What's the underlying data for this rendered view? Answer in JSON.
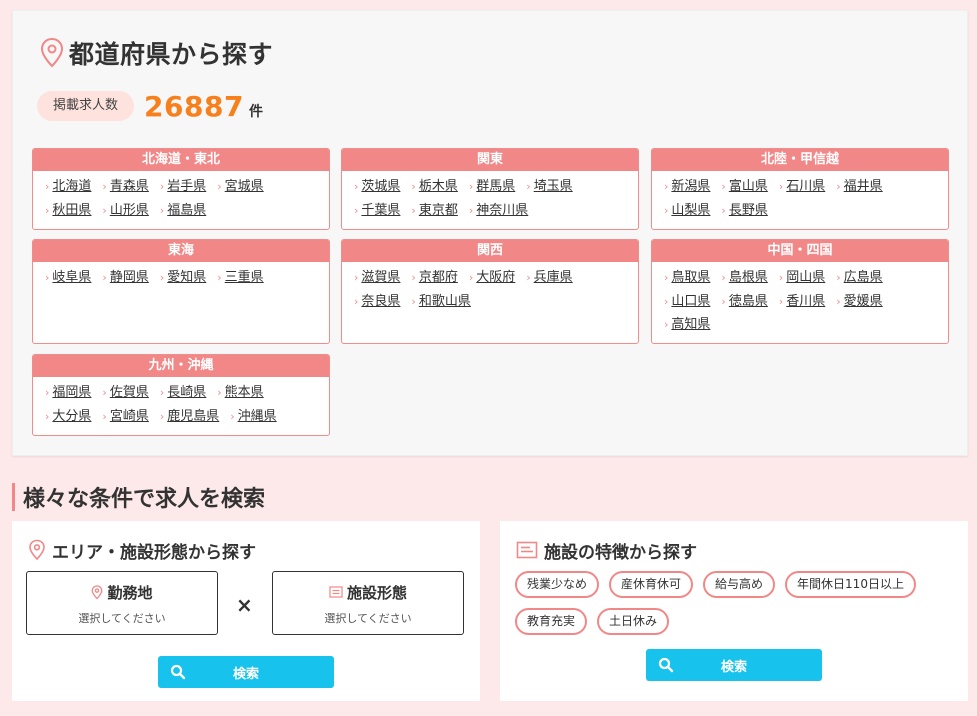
{
  "prefecture_section": {
    "title": "都道府県から探す",
    "count_label": "掲載求人数",
    "count_value": "26887",
    "count_unit": "件",
    "regions": [
      {
        "name": "北海道・東北",
        "prefectures": [
          "北海道",
          "青森県",
          "岩手県",
          "宮城県",
          "秋田県",
          "山形県",
          "福島県"
        ]
      },
      {
        "name": "関東",
        "prefectures": [
          "茨城県",
          "栃木県",
          "群馬県",
          "埼玉県",
          "千葉県",
          "東京都",
          "神奈川県"
        ]
      },
      {
        "name": "北陸・甲信越",
        "prefectures": [
          "新潟県",
          "富山県",
          "石川県",
          "福井県",
          "山梨県",
          "長野県"
        ]
      },
      {
        "name": "東海",
        "prefectures": [
          "岐阜県",
          "静岡県",
          "愛知県",
          "三重県"
        ]
      },
      {
        "name": "関西",
        "prefectures": [
          "滋賀県",
          "京都府",
          "大阪府",
          "兵庫県",
          "奈良県",
          "和歌山県"
        ]
      },
      {
        "name": "中国・四国",
        "prefectures": [
          "鳥取県",
          "島根県",
          "岡山県",
          "広島県",
          "山口県",
          "徳島県",
          "香川県",
          "愛媛県",
          "高知県"
        ]
      },
      {
        "name": "九州・沖縄",
        "prefectures": [
          "福岡県",
          "佐賀県",
          "長崎県",
          "熊本県",
          "大分県",
          "宮崎県",
          "鹿児島県",
          "沖縄県"
        ]
      }
    ]
  },
  "condition_section": {
    "title": "様々な条件で求人を検索",
    "area": {
      "title": "エリア・施設形態から探す",
      "workplace_label": "勤務地",
      "workplace_placeholder": "選択してください",
      "times": "×",
      "facility_label": "施設形態",
      "facility_placeholder": "選択してください",
      "search_label": "検索"
    },
    "features": {
      "title": "施設の特徴から探す",
      "tags": [
        "残業少なめ",
        "産休育休可",
        "給与高め",
        "年間休日110日以上",
        "教育充実",
        "土日休み"
      ],
      "search_label": "検索"
    }
  },
  "colors": {
    "accent": "#f28787",
    "count": "#f7801c",
    "button": "#17c3ec",
    "background": "#fde9e9"
  }
}
